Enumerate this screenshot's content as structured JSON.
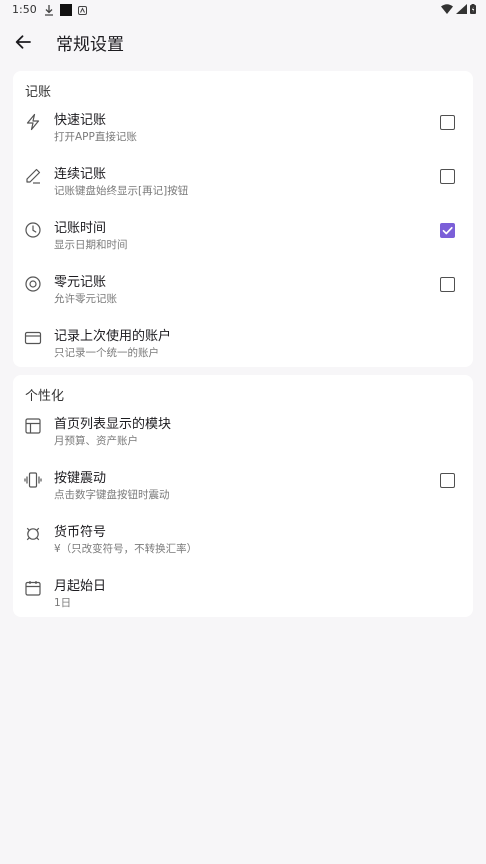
{
  "status": {
    "time": "1:50"
  },
  "header": {
    "title": "常规设置"
  },
  "accent_color": "#7b5fd8",
  "sections": [
    {
      "title": "记账",
      "items": [
        {
          "icon": "lightning-icon",
          "title": "快速记账",
          "subtitle": "打开APP直接记账",
          "checked": false
        },
        {
          "icon": "pencil-icon",
          "title": "连续记账",
          "subtitle": "记账键盘始终显示[再记]按钮",
          "checked": false
        },
        {
          "icon": "clock-icon",
          "title": "记账时间",
          "subtitle": "显示日期和时间",
          "checked": true
        },
        {
          "icon": "radio-circle-icon",
          "title": "零元记账",
          "subtitle": "允许零元记账",
          "checked": false
        },
        {
          "icon": "credit-card-icon",
          "title": "记录上次使用的账户",
          "subtitle": "只记录一个统一的账户"
        }
      ]
    },
    {
      "title": "个性化",
      "items": [
        {
          "icon": "layout-icon",
          "title": "首页列表显示的模块",
          "subtitle": "月预算、资产账户"
        },
        {
          "icon": "vibration-icon",
          "title": "按键震动",
          "subtitle": "点击数字键盘按钮时震动",
          "checked": false
        },
        {
          "icon": "currency-icon",
          "title": "货币符号",
          "subtitle": "¥（只改变符号，不转换汇率）"
        },
        {
          "icon": "calendar-icon",
          "title": "月起始日",
          "subtitle": "1日"
        }
      ]
    }
  ]
}
